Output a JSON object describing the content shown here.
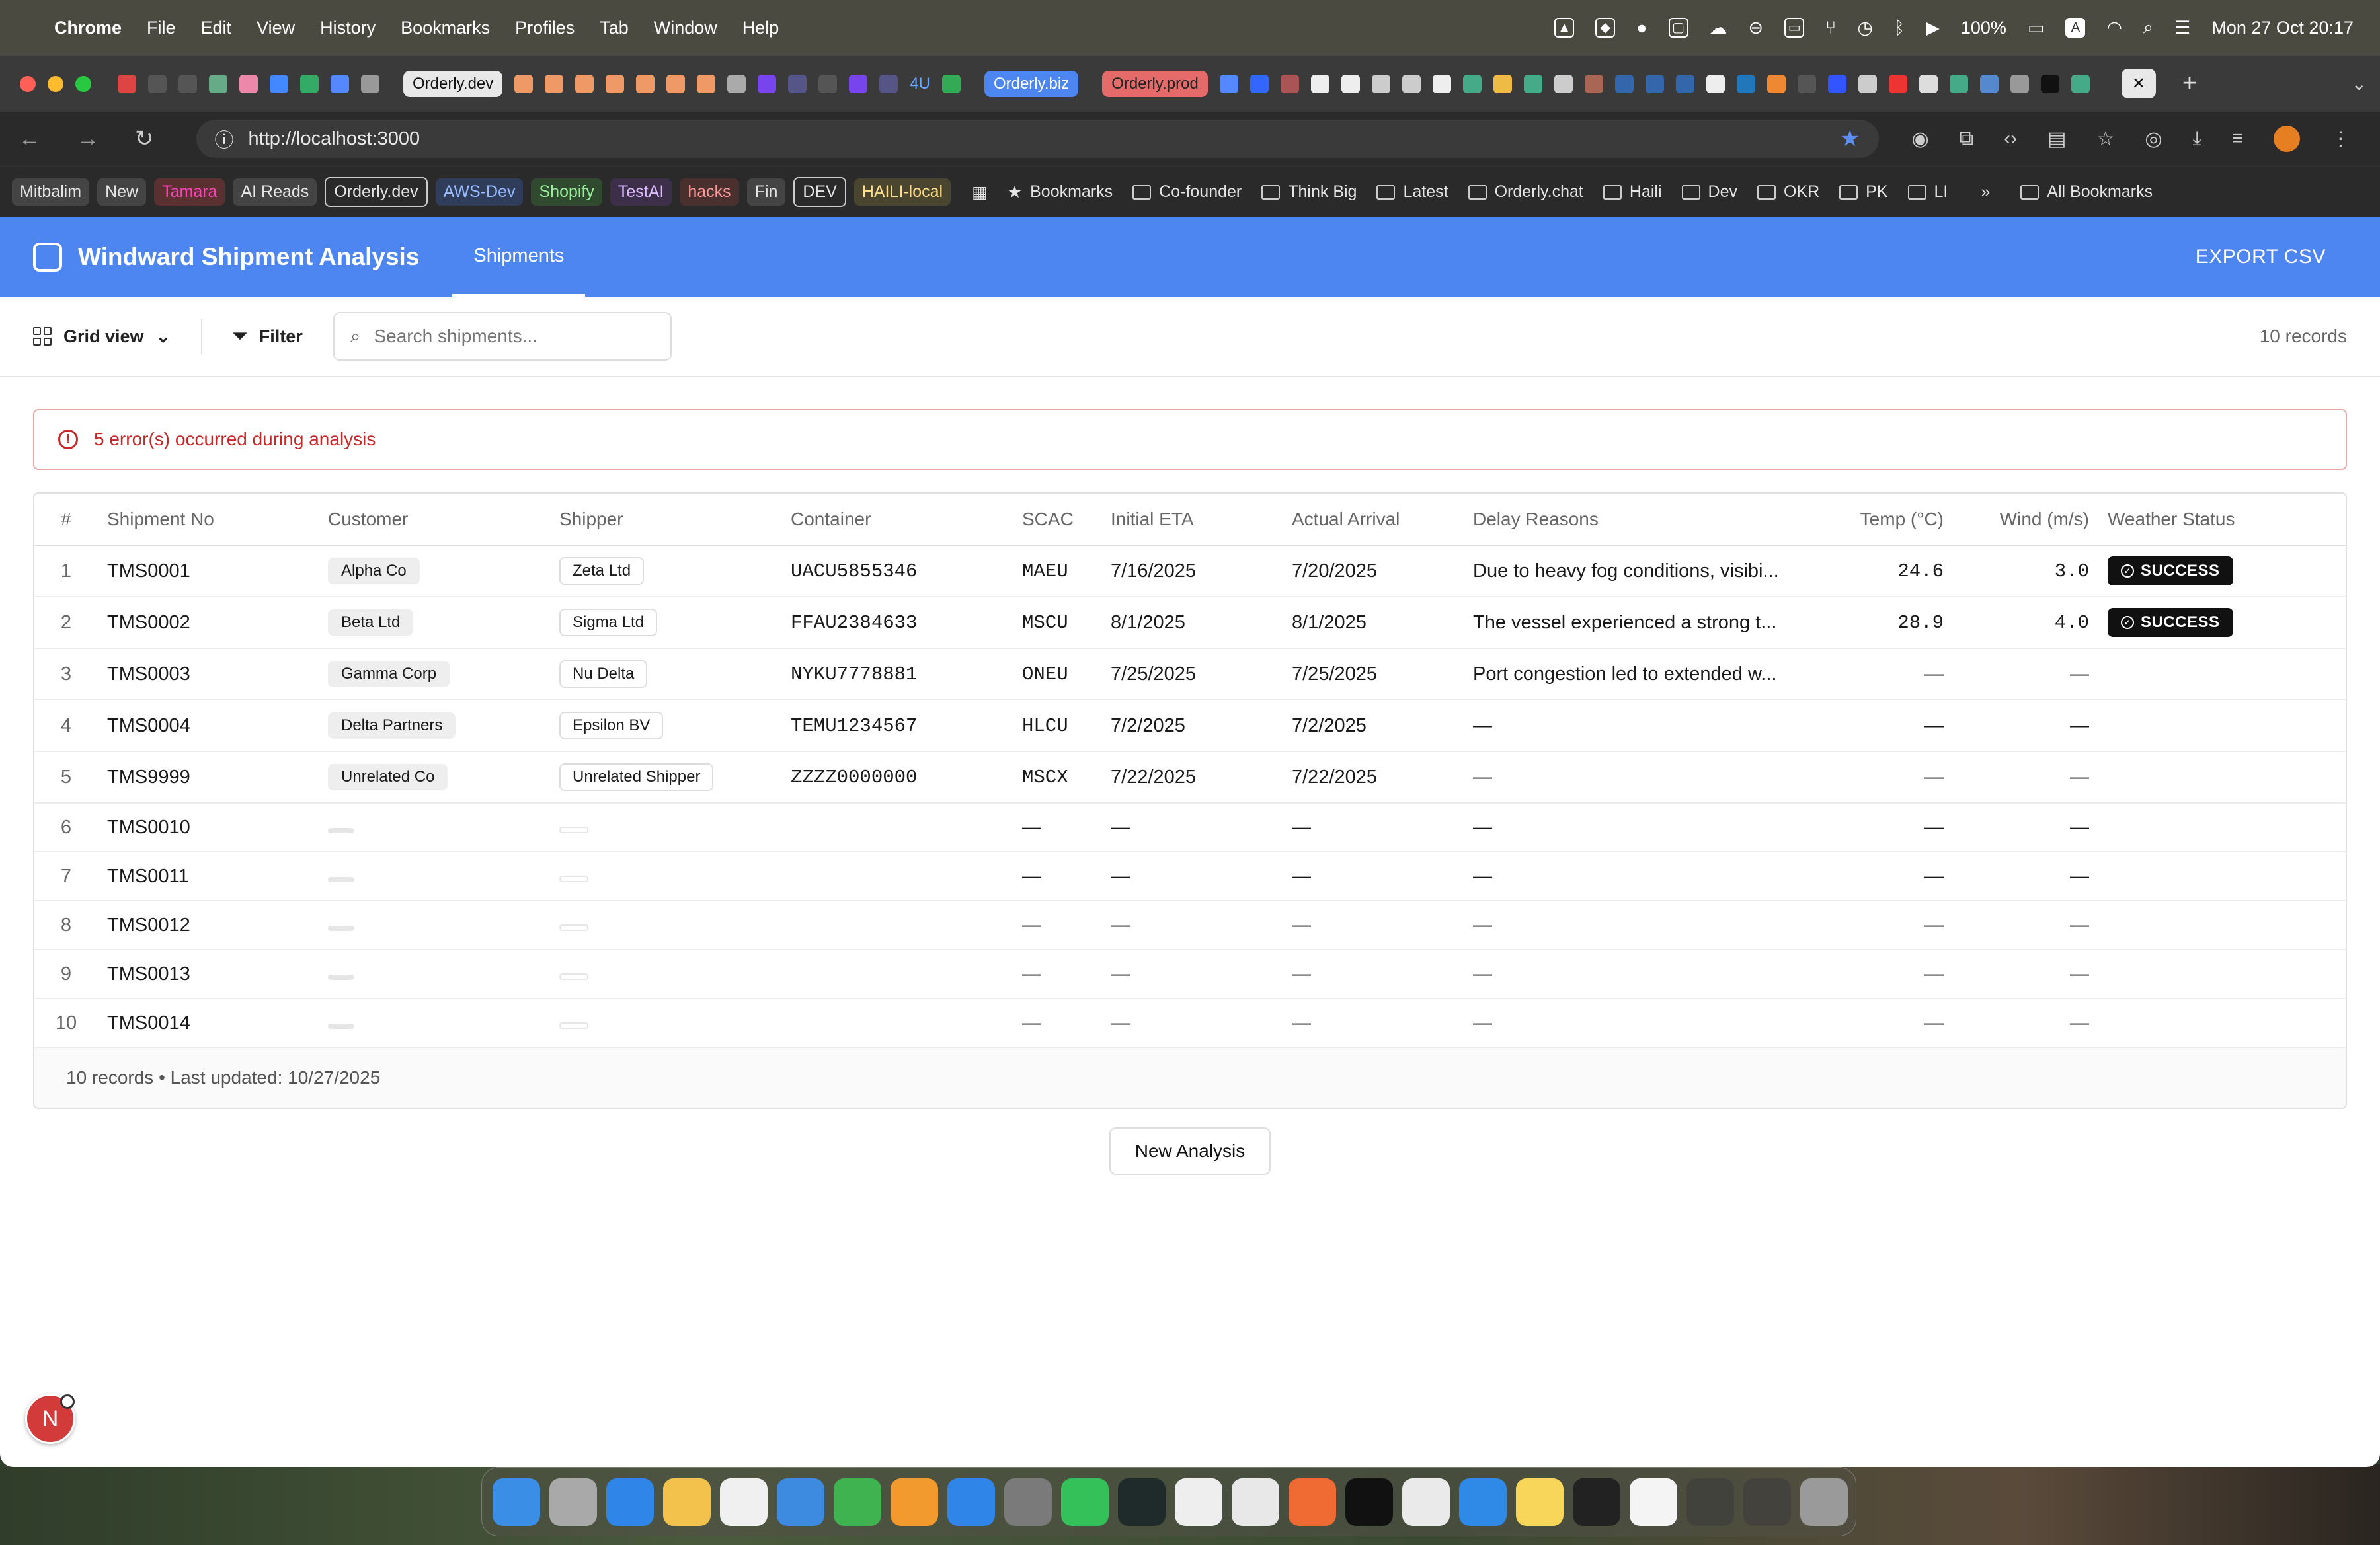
{
  "menubar": {
    "app": "Chrome",
    "items": [
      "File",
      "Edit",
      "View",
      "History",
      "Bookmarks",
      "Profiles",
      "Tab",
      "Window",
      "Help"
    ],
    "battery": "100%",
    "input_source": "A",
    "datetime": "Mon 27 Oct  20:17"
  },
  "browser": {
    "tabs": {
      "pill_left": "Orderly.dev",
      "pill_4u": "4U",
      "pill_biz": "Orderly.biz",
      "pill_prod": "Orderly.prod"
    },
    "url": "http://localhost:3000",
    "bookmarks": [
      "Mitbalim",
      "New",
      "Tamara",
      "AI Reads",
      "Orderly.dev",
      "AWS-Dev",
      "Shopify",
      "TestAI",
      "hacks",
      "Fin",
      "DEV",
      "HAILI-local"
    ],
    "bookmark_folders": [
      "Bookmarks",
      "Co-founder",
      "Think Big",
      "Latest",
      "Orderly.chat",
      "Haili",
      "Dev",
      "OKR",
      "PK",
      "LI"
    ],
    "more": "»",
    "all_bookmarks": "All Bookmarks"
  },
  "app": {
    "title": "Windward Shipment Analysis",
    "tab": "Shipments",
    "export": "EXPORT CSV",
    "view_label": "Grid view",
    "filter_label": "Filter",
    "search_placeholder": "Search shipments...",
    "record_count": "10 records",
    "error_text": "5 error(s) occurred during analysis",
    "columns": [
      "#",
      "Shipment No",
      "Customer",
      "Shipper",
      "Container",
      "SCAC",
      "Initial ETA",
      "Actual Arrival",
      "Delay Reasons",
      "Temp (°C)",
      "Wind (m/s)",
      "Weather Status"
    ],
    "rows": [
      {
        "n": "1",
        "ship": "TMS0001",
        "cust": "Alpha Co",
        "shipper": "Zeta Ltd",
        "cont": "UACU5855346",
        "scac": "MAEU",
        "eta": "7/16/2025",
        "arr": "7/20/2025",
        "delay": "Due to heavy fog conditions, visibi...",
        "temp": "24.6",
        "wind": "3.0",
        "status": "SUCCESS"
      },
      {
        "n": "2",
        "ship": "TMS0002",
        "cust": "Beta Ltd",
        "shipper": "Sigma Ltd",
        "cont": "FFAU2384633",
        "scac": "MSCU",
        "eta": "8/1/2025",
        "arr": "8/1/2025",
        "delay": "The vessel experienced a strong t...",
        "temp": "28.9",
        "wind": "4.0",
        "status": "SUCCESS"
      },
      {
        "n": "3",
        "ship": "TMS0003",
        "cust": "Gamma Corp",
        "shipper": "Nu Delta",
        "cont": "NYKU7778881",
        "scac": "ONEU",
        "eta": "7/25/2025",
        "arr": "7/25/2025",
        "delay": "Port congestion led to extended w...",
        "temp": "—",
        "wind": "—",
        "status": ""
      },
      {
        "n": "4",
        "ship": "TMS0004",
        "cust": "Delta Partners",
        "shipper": "Epsilon BV",
        "cont": "TEMU1234567",
        "scac": "HLCU",
        "eta": "7/2/2025",
        "arr": "7/2/2025",
        "delay": "—",
        "temp": "—",
        "wind": "—",
        "status": ""
      },
      {
        "n": "5",
        "ship": "TMS9999",
        "cust": "Unrelated Co",
        "shipper": "Unrelated Shipper",
        "cont": "ZZZZ0000000",
        "scac": "MSCX",
        "eta": "7/22/2025",
        "arr": "7/22/2025",
        "delay": "—",
        "temp": "—",
        "wind": "—",
        "status": ""
      }
    ],
    "empty_rows": [
      {
        "n": "6",
        "ship": "TMS0010"
      },
      {
        "n": "7",
        "ship": "TMS0011"
      },
      {
        "n": "8",
        "ship": "TMS0012"
      },
      {
        "n": "9",
        "ship": "TMS0013"
      },
      {
        "n": "10",
        "ship": "TMS0014"
      }
    ],
    "dash": "—",
    "footer": "10 records • Last updated: 10/27/2025",
    "new_analysis": "New Analysis",
    "badge_letter": "N"
  },
  "colors": {
    "accent": "#4d86f0",
    "error": "#c62828"
  }
}
